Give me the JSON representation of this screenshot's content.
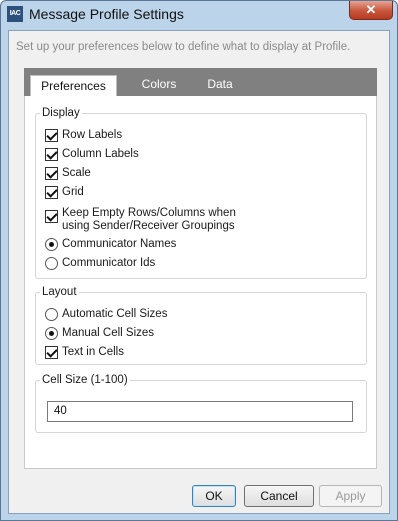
{
  "window": {
    "title": "Message Profile Settings",
    "app_icon_text": "IAC",
    "close_glyph": "✕"
  },
  "intro_text": "Set up your preferences below to define what to display at Profile.",
  "tabs": [
    {
      "label": "Preferences",
      "active": true
    },
    {
      "label": "Colors",
      "active": false
    },
    {
      "label": "Data",
      "active": false
    }
  ],
  "display_group": {
    "legend": "Display",
    "options": [
      {
        "label": "Row Labels",
        "type": "checkbox",
        "checked": true
      },
      {
        "label": "Column Labels",
        "type": "checkbox",
        "checked": true
      },
      {
        "label": "Scale",
        "type": "checkbox",
        "checked": true
      },
      {
        "label": "Grid",
        "type": "checkbox",
        "checked": true
      },
      {
        "label_line1": "Keep Empty Rows/Columns when",
        "label_line2": "using Sender/Receiver Groupings",
        "type": "checkbox",
        "checked": true
      },
      {
        "label": "Communicator Names",
        "type": "radio",
        "checked": true
      },
      {
        "label": "Communicator Ids",
        "type": "radio",
        "checked": false
      }
    ]
  },
  "layout_group": {
    "legend": "Layout",
    "options": [
      {
        "label": "Automatic Cell Sizes",
        "type": "radio",
        "checked": false
      },
      {
        "label": "Manual Cell Sizes",
        "type": "radio",
        "checked": true
      },
      {
        "label": "Text in Cells",
        "type": "checkbox",
        "checked": true
      }
    ]
  },
  "cell_size_group": {
    "legend": "Cell Size (1-100)",
    "value": "40"
  },
  "buttons": {
    "ok": "OK",
    "cancel": "Cancel",
    "apply": "Apply"
  }
}
